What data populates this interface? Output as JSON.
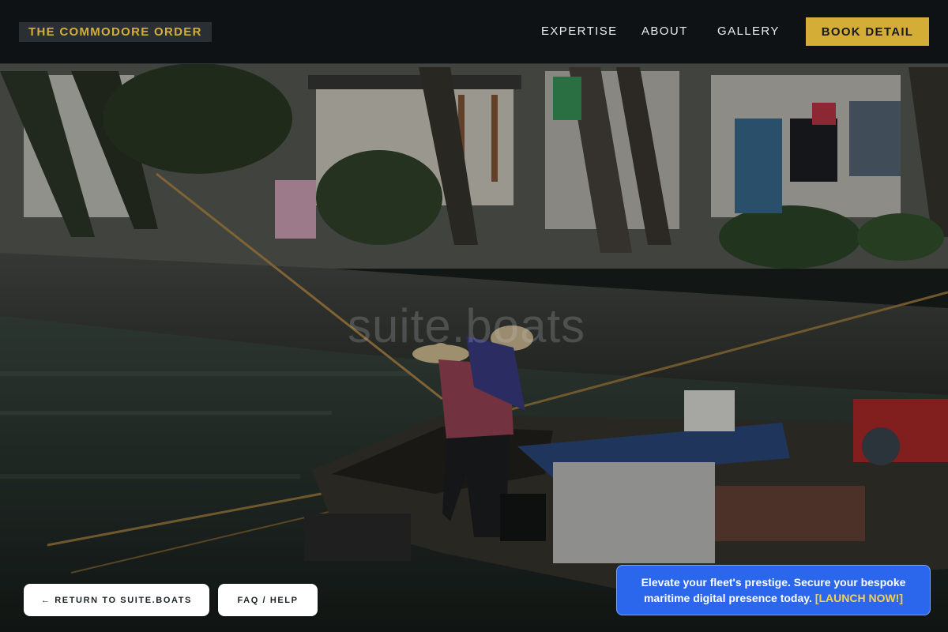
{
  "header": {
    "brand": "THE COMMODORE ORDER",
    "nav": [
      "EXPERTISE",
      "ABOUT",
      "GALLERY"
    ],
    "cta": "BOOK DETAIL"
  },
  "hero": {
    "watermark": "suite.boats"
  },
  "footer": {
    "return_label": "← RETURN TO SUITE.BOATS",
    "faq_label": "FAQ / HELP"
  },
  "promo": {
    "text": "Elevate your fleet's prestige. Secure your bespoke maritime digital presence today.",
    "cta": "[LAUNCH NOW!]"
  },
  "colors": {
    "accent": "#d4ad36",
    "header_bg": "#0e1216",
    "promo_bg": "#2a67ec",
    "promo_cta": "#f6d24b"
  }
}
